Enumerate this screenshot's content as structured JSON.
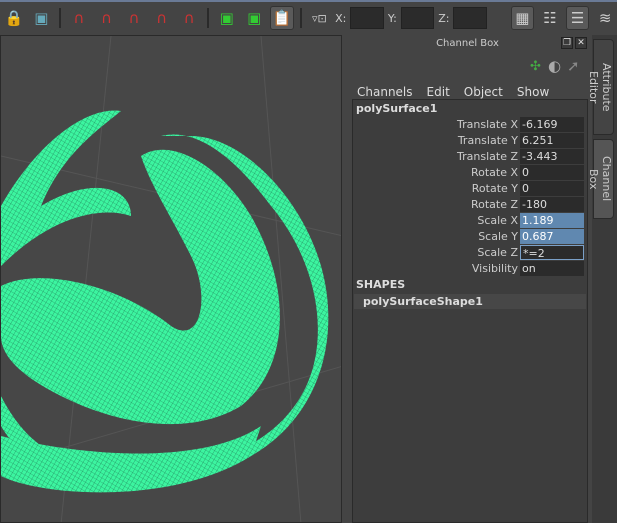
{
  "toolbar": {
    "coord_x": "X:",
    "coord_y": "Y:",
    "coord_z": "Z:"
  },
  "panel": {
    "title": "Channel Box",
    "menu": [
      "Channels",
      "Edit",
      "Object",
      "Show"
    ]
  },
  "channel_box": {
    "object": "polySurface1",
    "channels": [
      {
        "label": "Translate X",
        "value": "-6.169",
        "state": "normal"
      },
      {
        "label": "Translate Y",
        "value": "6.251",
        "state": "normal"
      },
      {
        "label": "Translate Z",
        "value": "-3.443",
        "state": "normal"
      },
      {
        "label": "Rotate X",
        "value": "0",
        "state": "normal"
      },
      {
        "label": "Rotate Y",
        "value": "0",
        "state": "normal"
      },
      {
        "label": "Rotate Z",
        "value": "-180",
        "state": "normal"
      },
      {
        "label": "Scale X",
        "value": "1.189",
        "state": "selected"
      },
      {
        "label": "Scale Y",
        "value": "0.687",
        "state": "selected"
      },
      {
        "label": "Scale Z",
        "value": "*=2",
        "state": "editing"
      },
      {
        "label": "Visibility",
        "value": "on",
        "state": "normal"
      }
    ],
    "shapes_header": "SHAPES",
    "shape": "polySurfaceShape1"
  },
  "tabs": {
    "attribute_editor": "Attribute Editor",
    "channel_box": "Channel Box"
  },
  "colors": {
    "wireframe": "#3cf5a0",
    "selection": "#6088b0"
  }
}
